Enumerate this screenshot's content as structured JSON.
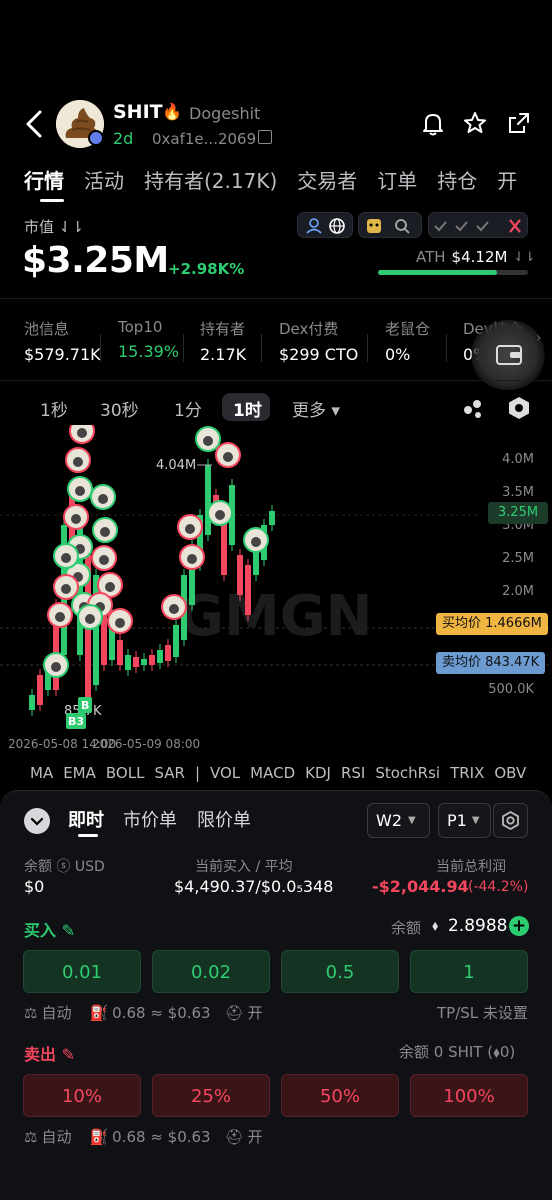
{
  "token": {
    "symbol": "SHIT",
    "name": "Dogeshit",
    "age": "2d",
    "address": "0xaf1e...2069"
  },
  "tabs": [
    "行情",
    "活动",
    "持有者(2.17K)",
    "交易者",
    "订单",
    "持仓",
    "开"
  ],
  "market": {
    "label": "市值 ⇃⇂",
    "value": "$3.25M",
    "change": "+2.98K%",
    "ath_label": "ATH",
    "ath_value": "$4.12M",
    "ath_progress": 0.79
  },
  "stats": [
    {
      "label": "池信息",
      "value": "$579.71K",
      "color": "#ffffff"
    },
    {
      "label": "Top10",
      "value": "15.39%",
      "color": "#2ecc71"
    },
    {
      "label": "持有者",
      "value": "2.17K",
      "color": "#ffffff"
    },
    {
      "label": "Dex付费",
      "value": "$299 CTO",
      "color": "#ffffff"
    },
    {
      "label": "老鼠仓",
      "value": "0%",
      "color": "#ffffff"
    },
    {
      "label": "Dev持仓",
      "value": "0%",
      "color": "#ffffff"
    }
  ],
  "timeframes": [
    "1秒",
    "30秒",
    "1分",
    "1时",
    "更多 ▾"
  ],
  "active_timeframe": "1时",
  "chart_data": {
    "type": "candlestick",
    "y_ticks": [
      "4.0M",
      "3.5M",
      "3.0M",
      "2.5M",
      "2.0M",
      "500.0K"
    ],
    "current_price": "3.25M",
    "high_marker": "4.04M",
    "low_marker": "85.7K",
    "buy_avg": "买均价 1.4666M",
    "sell_avg": "卖均价 843.47K",
    "x_labels": [
      "2026-05-08 14:00",
      "2026-05-09 08:00"
    ],
    "markers": [
      "B3",
      "B"
    ],
    "watermark": "GMGN"
  },
  "indicators": [
    "MA",
    "EMA",
    "BOLL",
    "SAR",
    "|",
    "VOL",
    "MACD",
    "KDJ",
    "RSI",
    "StochRsi",
    "TRIX",
    "OBV"
  ],
  "trade": {
    "tabs": [
      "即时",
      "市价单",
      "限价单"
    ],
    "wallet_select": "W2",
    "preset_select": "P1",
    "balance_label": "余额 ⓢ USD",
    "balance_value": "$0",
    "current_buy_label": "当前买入 / 平均",
    "current_buy_value": "$4,490.37/$0.0₅348",
    "pnl_label": "当前总利润",
    "pnl_value": "-$2,044.94",
    "pnl_pct": "(-44.2%)",
    "buy_label": "买入 ✎",
    "buy_balance_label": "余额",
    "buy_balance_value": "2.8988",
    "buy_amounts": [
      "0.01",
      "0.02",
      "0.5",
      "1"
    ],
    "buy_meta_auto": "自动",
    "buy_meta_gas": "0.68 ≈ $0.63",
    "buy_meta_mev": "开",
    "tpsl": "TP/SL 未设置",
    "sell_label": "卖出 ✎",
    "sell_balance": "余额 0 SHIT (⬧0)",
    "sell_pcts": [
      "10%",
      "25%",
      "50%",
      "100%"
    ],
    "sell_meta_auto": "自动",
    "sell_meta_gas": "0.68 ≈ $0.63",
    "sell_meta_mev": "开"
  }
}
